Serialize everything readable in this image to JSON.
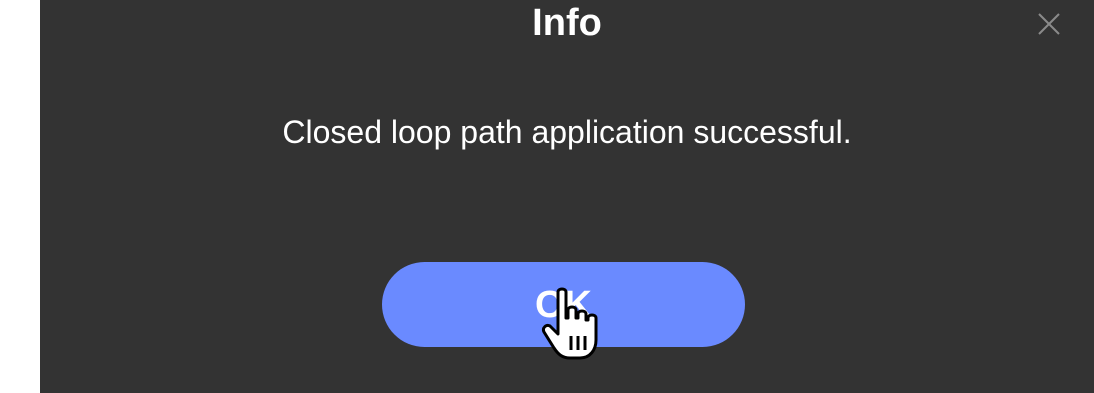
{
  "dialog": {
    "title": "Info",
    "message": "Closed loop path application successful.",
    "ok_label": "OK",
    "close_icon": "close-icon",
    "cursor_icon": "hand-pointer-icon"
  },
  "colors": {
    "dialog_background": "#333333",
    "button_background": "#6a8aff",
    "text": "#ffffff"
  }
}
